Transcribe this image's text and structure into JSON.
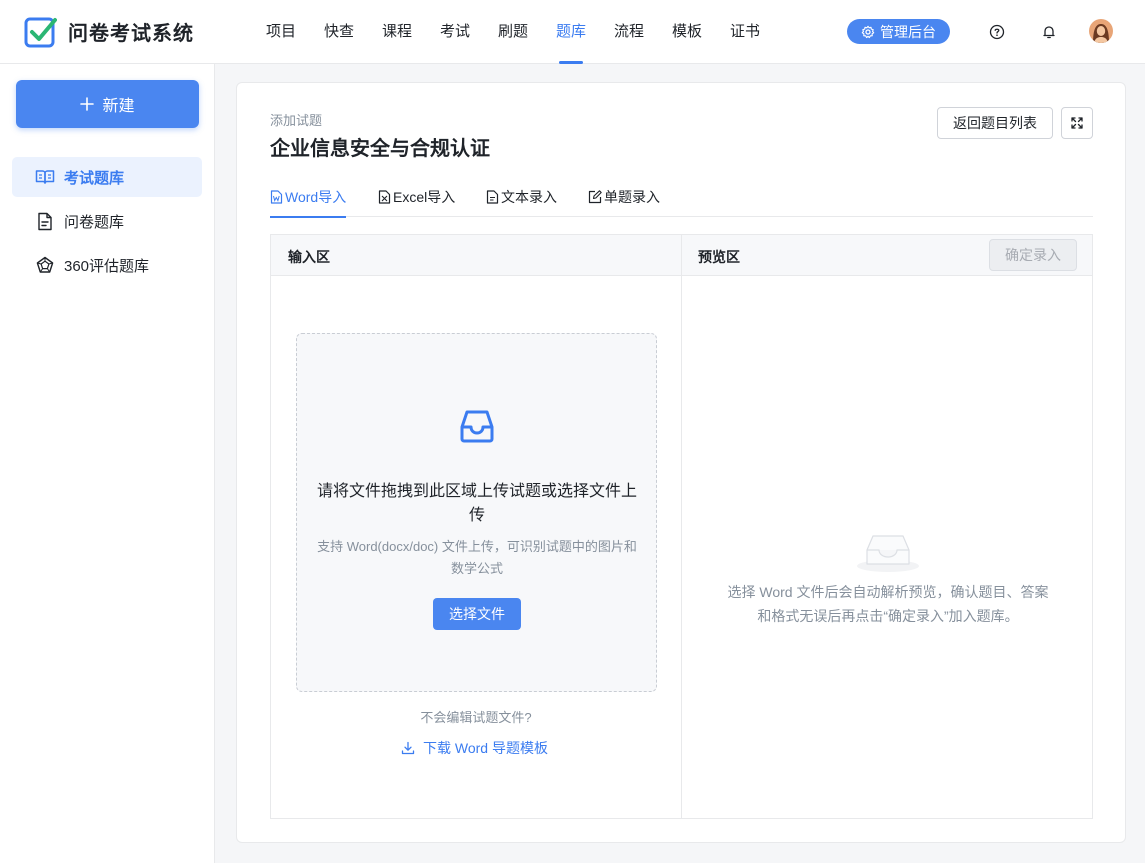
{
  "app": {
    "title": "问卷考试系统"
  },
  "nav": {
    "items": [
      {
        "label": "项目"
      },
      {
        "label": "快查"
      },
      {
        "label": "课程"
      },
      {
        "label": "考试"
      },
      {
        "label": "刷题"
      },
      {
        "label": "题库",
        "active": true
      },
      {
        "label": "流程"
      },
      {
        "label": "模板"
      },
      {
        "label": "证书"
      }
    ],
    "admin_label": "管理后台",
    "accent_color": "#3b7cf0"
  },
  "sidebar": {
    "new_label": "新建",
    "items": [
      {
        "label": "考试题库",
        "icon": "book-open-icon",
        "active": true
      },
      {
        "label": "问卷题库",
        "icon": "document-icon"
      },
      {
        "label": "360评估题库",
        "icon": "pentagon-icon"
      }
    ]
  },
  "page": {
    "breadcrumb": "添加试题",
    "title": "企业信息安全与合规认证",
    "back_label": "返回题目列表"
  },
  "tabs": [
    {
      "label": "Word导入",
      "icon": "word-file-icon",
      "active": true
    },
    {
      "label": "Excel导入",
      "icon": "excel-file-icon"
    },
    {
      "label": "文本录入",
      "icon": "text-file-icon"
    },
    {
      "label": "单题录入",
      "icon": "edit-icon"
    }
  ],
  "input_area": {
    "header": "输入区",
    "drop_main": "请将文件拖拽到此区域上传试题或选择文件上传",
    "drop_sub": "支持 Word(docx/doc) 文件上传，可识别试题中的图片和数学公式",
    "choose_label": "选择文件",
    "hint": "不会编辑试题文件?",
    "download_label": "下载 Word 导题模板"
  },
  "preview_area": {
    "header": "预览区",
    "confirm_label": "确定录入",
    "empty_text": "选择 Word 文件后会自动解析预览，确认题目、答案和格式无误后再点击“确定录入”加入题库。"
  }
}
